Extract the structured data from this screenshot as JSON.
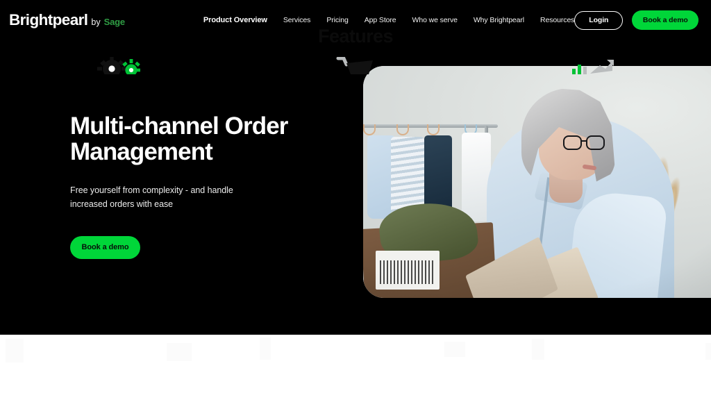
{
  "brand": {
    "name": "Brightpearl",
    "by": "by",
    "parent": "Sage",
    "sage_green": "#2f9c44"
  },
  "nav": {
    "links": [
      {
        "label": "Product Overview",
        "active": true
      },
      {
        "label": "Services",
        "active": false
      },
      {
        "label": "Pricing",
        "active": false
      },
      {
        "label": "App Store",
        "active": false
      },
      {
        "label": "Who we serve",
        "active": false
      },
      {
        "label": "Why Brightpearl",
        "active": false
      },
      {
        "label": "Resources",
        "active": false
      }
    ],
    "login_label": "Login",
    "demo_label": "Book a demo"
  },
  "hero": {
    "title": "Multi-channel Order Management",
    "subtitle": "Free yourself from complexity - and handle increased orders with ease",
    "cta_label": "Book a demo",
    "image_alt": "Woman with grey hair and glasses in a light blue shirt packing clothing into a cardboard box beside a clothing rail and pampas grass",
    "background_color": "#000000",
    "accent_green": "#00d639"
  },
  "features": {
    "title": "Features",
    "icons": [
      {
        "name": "gears-automation-icon",
        "label": "Automation"
      },
      {
        "name": "shopping-cart-icon",
        "label": "Order capture"
      },
      {
        "name": "bar-chart-growth-icon",
        "label": "Reporting"
      }
    ]
  }
}
